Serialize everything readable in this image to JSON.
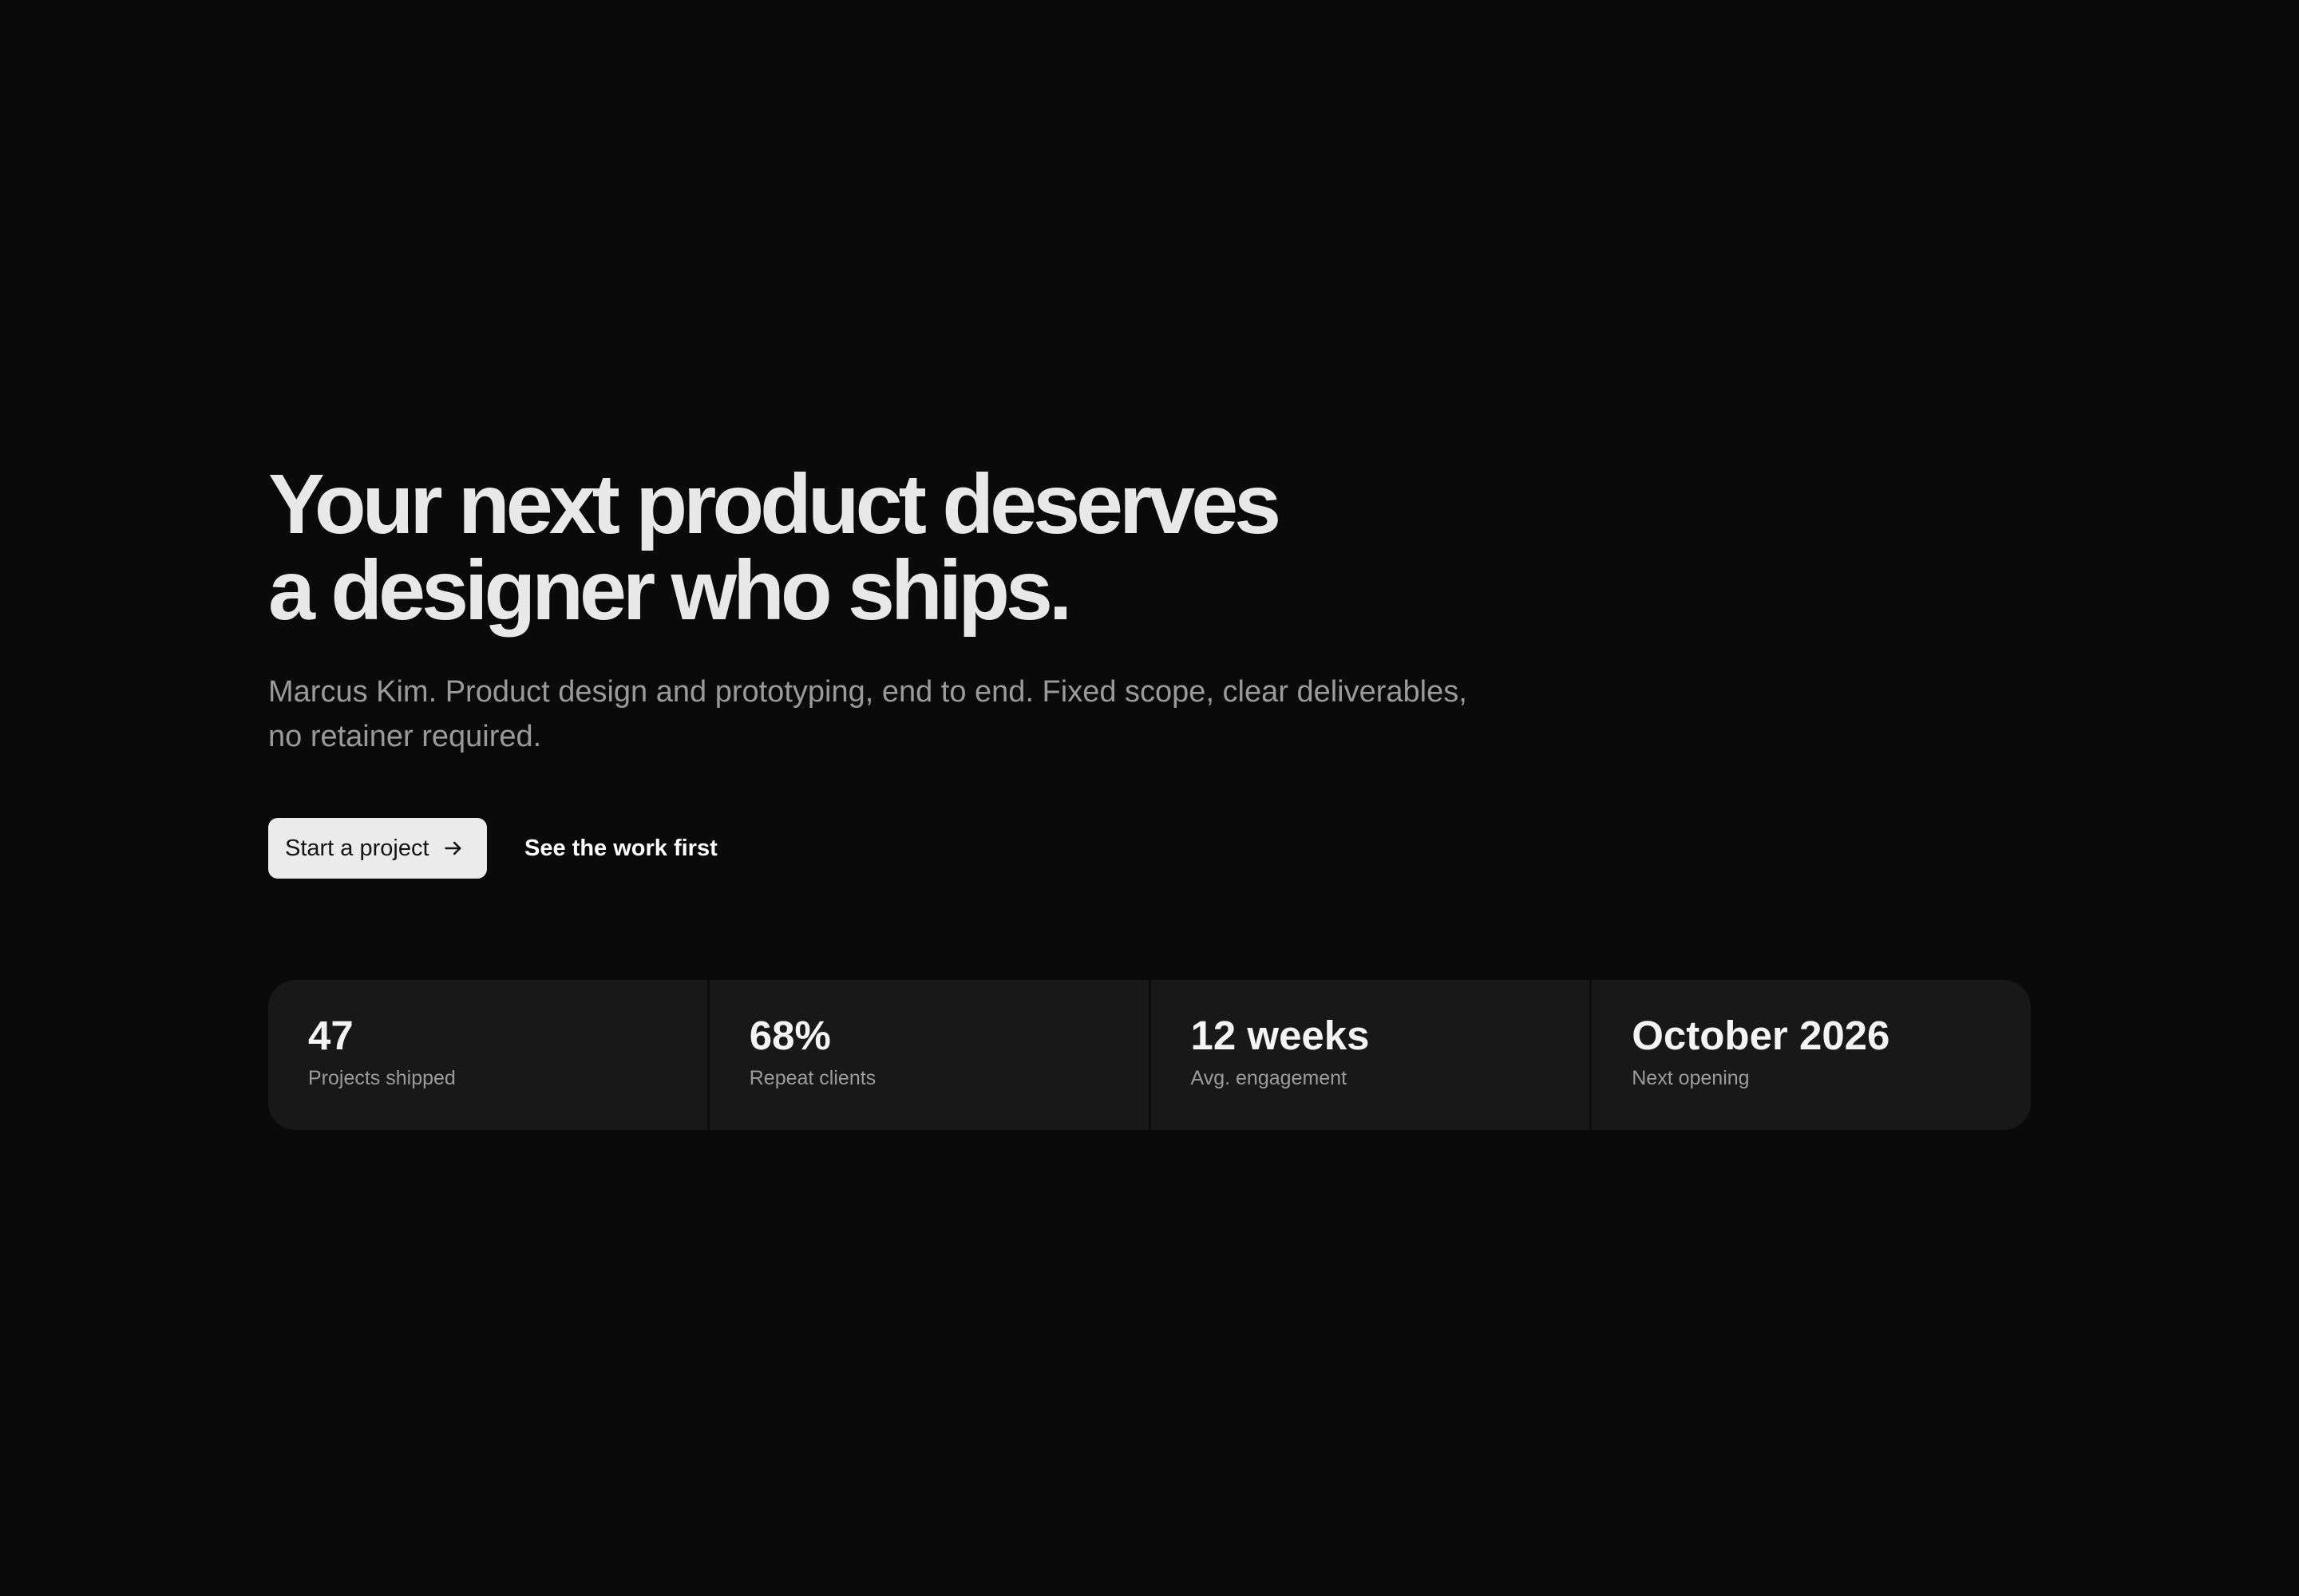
{
  "hero": {
    "headline_line1": "Your next product deserves",
    "headline_line2": "a designer who ships.",
    "subtitle_line1": "Marcus Kim. Product design and prototyping, end to end. Fixed scope, clear deliverables,",
    "subtitle_line2": "no retainer required."
  },
  "actions": {
    "primary_label": "Start a project",
    "primary_icon": "arrow-right-icon",
    "secondary_label": "See the work first"
  },
  "stats": [
    {
      "value": "47",
      "label": "Projects shipped"
    },
    {
      "value": "68%",
      "label": "Repeat clients"
    },
    {
      "value": "12 weeks",
      "label": "Avg. engagement"
    },
    {
      "value": "October 2026",
      "label": "Next opening"
    }
  ],
  "colors": {
    "background": "#0a0a0a",
    "card": "#181818",
    "primary_button": "#ebebeb"
  }
}
